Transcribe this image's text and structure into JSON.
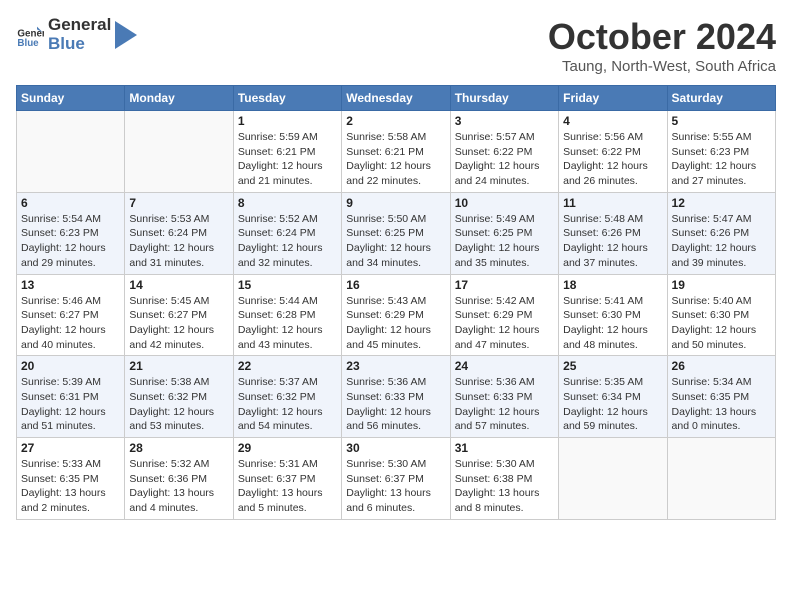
{
  "header": {
    "logo_general": "General",
    "logo_blue": "Blue",
    "month": "October 2024",
    "location": "Taung, North-West, South Africa"
  },
  "days_of_week": [
    "Sunday",
    "Monday",
    "Tuesday",
    "Wednesday",
    "Thursday",
    "Friday",
    "Saturday"
  ],
  "weeks": [
    [
      {
        "day": "",
        "empty": true
      },
      {
        "day": "",
        "empty": true
      },
      {
        "day": "1",
        "sunrise": "5:59 AM",
        "sunset": "6:21 PM",
        "daylight": "12 hours and 21 minutes."
      },
      {
        "day": "2",
        "sunrise": "5:58 AM",
        "sunset": "6:21 PM",
        "daylight": "12 hours and 22 minutes."
      },
      {
        "day": "3",
        "sunrise": "5:57 AM",
        "sunset": "6:22 PM",
        "daylight": "12 hours and 24 minutes."
      },
      {
        "day": "4",
        "sunrise": "5:56 AM",
        "sunset": "6:22 PM",
        "daylight": "12 hours and 26 minutes."
      },
      {
        "day": "5",
        "sunrise": "5:55 AM",
        "sunset": "6:23 PM",
        "daylight": "12 hours and 27 minutes."
      }
    ],
    [
      {
        "day": "6",
        "sunrise": "5:54 AM",
        "sunset": "6:23 PM",
        "daylight": "12 hours and 29 minutes."
      },
      {
        "day": "7",
        "sunrise": "5:53 AM",
        "sunset": "6:24 PM",
        "daylight": "12 hours and 31 minutes."
      },
      {
        "day": "8",
        "sunrise": "5:52 AM",
        "sunset": "6:24 PM",
        "daylight": "12 hours and 32 minutes."
      },
      {
        "day": "9",
        "sunrise": "5:50 AM",
        "sunset": "6:25 PM",
        "daylight": "12 hours and 34 minutes."
      },
      {
        "day": "10",
        "sunrise": "5:49 AM",
        "sunset": "6:25 PM",
        "daylight": "12 hours and 35 minutes."
      },
      {
        "day": "11",
        "sunrise": "5:48 AM",
        "sunset": "6:26 PM",
        "daylight": "12 hours and 37 minutes."
      },
      {
        "day": "12",
        "sunrise": "5:47 AM",
        "sunset": "6:26 PM",
        "daylight": "12 hours and 39 minutes."
      }
    ],
    [
      {
        "day": "13",
        "sunrise": "5:46 AM",
        "sunset": "6:27 PM",
        "daylight": "12 hours and 40 minutes."
      },
      {
        "day": "14",
        "sunrise": "5:45 AM",
        "sunset": "6:27 PM",
        "daylight": "12 hours and 42 minutes."
      },
      {
        "day": "15",
        "sunrise": "5:44 AM",
        "sunset": "6:28 PM",
        "daylight": "12 hours and 43 minutes."
      },
      {
        "day": "16",
        "sunrise": "5:43 AM",
        "sunset": "6:29 PM",
        "daylight": "12 hours and 45 minutes."
      },
      {
        "day": "17",
        "sunrise": "5:42 AM",
        "sunset": "6:29 PM",
        "daylight": "12 hours and 47 minutes."
      },
      {
        "day": "18",
        "sunrise": "5:41 AM",
        "sunset": "6:30 PM",
        "daylight": "12 hours and 48 minutes."
      },
      {
        "day": "19",
        "sunrise": "5:40 AM",
        "sunset": "6:30 PM",
        "daylight": "12 hours and 50 minutes."
      }
    ],
    [
      {
        "day": "20",
        "sunrise": "5:39 AM",
        "sunset": "6:31 PM",
        "daylight": "12 hours and 51 minutes."
      },
      {
        "day": "21",
        "sunrise": "5:38 AM",
        "sunset": "6:32 PM",
        "daylight": "12 hours and 53 minutes."
      },
      {
        "day": "22",
        "sunrise": "5:37 AM",
        "sunset": "6:32 PM",
        "daylight": "12 hours and 54 minutes."
      },
      {
        "day": "23",
        "sunrise": "5:36 AM",
        "sunset": "6:33 PM",
        "daylight": "12 hours and 56 minutes."
      },
      {
        "day": "24",
        "sunrise": "5:36 AM",
        "sunset": "6:33 PM",
        "daylight": "12 hours and 57 minutes."
      },
      {
        "day": "25",
        "sunrise": "5:35 AM",
        "sunset": "6:34 PM",
        "daylight": "12 hours and 59 minutes."
      },
      {
        "day": "26",
        "sunrise": "5:34 AM",
        "sunset": "6:35 PM",
        "daylight": "13 hours and 0 minutes."
      }
    ],
    [
      {
        "day": "27",
        "sunrise": "5:33 AM",
        "sunset": "6:35 PM",
        "daylight": "13 hours and 2 minutes."
      },
      {
        "day": "28",
        "sunrise": "5:32 AM",
        "sunset": "6:36 PM",
        "daylight": "13 hours and 4 minutes."
      },
      {
        "day": "29",
        "sunrise": "5:31 AM",
        "sunset": "6:37 PM",
        "daylight": "13 hours and 5 minutes."
      },
      {
        "day": "30",
        "sunrise": "5:30 AM",
        "sunset": "6:37 PM",
        "daylight": "13 hours and 6 minutes."
      },
      {
        "day": "31",
        "sunrise": "5:30 AM",
        "sunset": "6:38 PM",
        "daylight": "13 hours and 8 minutes."
      },
      {
        "day": "",
        "empty": true
      },
      {
        "day": "",
        "empty": true
      }
    ]
  ]
}
